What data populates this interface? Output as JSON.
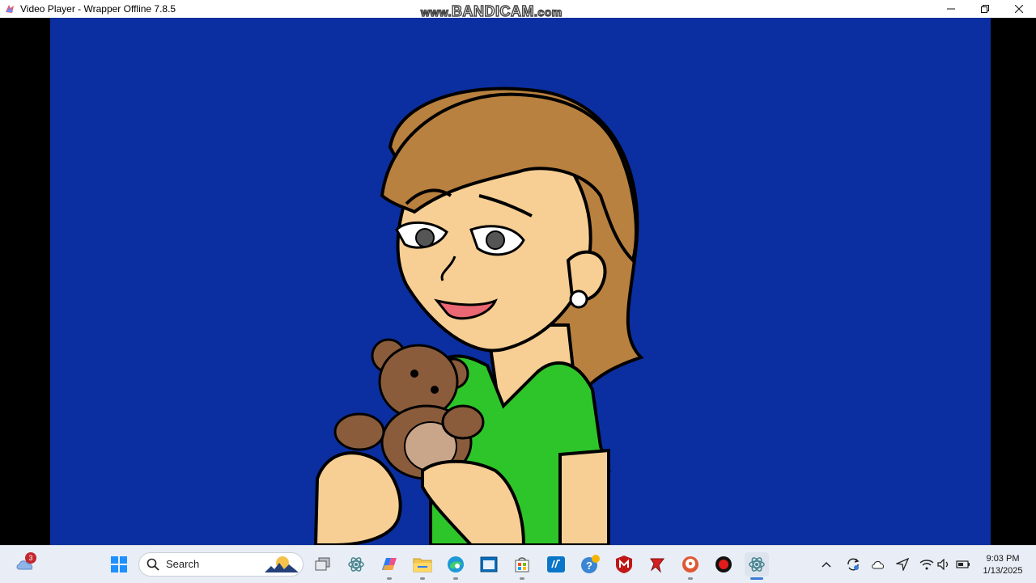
{
  "window": {
    "title": "Video Player - Wrapper Offline 7.8.5",
    "controls": [
      "minimize",
      "restore",
      "close"
    ]
  },
  "watermark": {
    "prefix": "www.",
    "brand": "BANDICAM",
    "suffix": ".com"
  },
  "video": {
    "background_color": "#0b2fa0",
    "scene": "cartoon-woman-holding-teddy-bear"
  },
  "taskbar": {
    "weather_badge": "3",
    "search_placeholder": "Search",
    "apps": [
      {
        "icon": "windows-start-icon"
      },
      {
        "icon": "task-view-icon"
      },
      {
        "icon": "electron-app-icon"
      },
      {
        "icon": "copilot-icon"
      },
      {
        "icon": "file-explorer-icon"
      },
      {
        "icon": "edge-icon"
      },
      {
        "icon": "store-window-icon"
      },
      {
        "icon": "microsoft-store-icon"
      },
      {
        "icon": "hp-icon"
      },
      {
        "icon": "help-icon"
      },
      {
        "icon": "mcafee-icon"
      },
      {
        "icon": "red-app-icon"
      },
      {
        "icon": "duckduckgo-icon"
      },
      {
        "icon": "record-icon"
      },
      {
        "icon": "wrapper-offline-icon"
      }
    ],
    "tray": [
      "chevron-up-icon",
      "sync-icon",
      "onedrive-icon",
      "location-icon",
      "wifi-icon",
      "volume-icon",
      "battery-icon"
    ],
    "time": "9:03 PM",
    "date": "1/13/2025"
  },
  "colors": {
    "video_bg": "#0b2fa0",
    "taskbar_bg": "#e9eef6",
    "accent": "#3a7bd5"
  }
}
